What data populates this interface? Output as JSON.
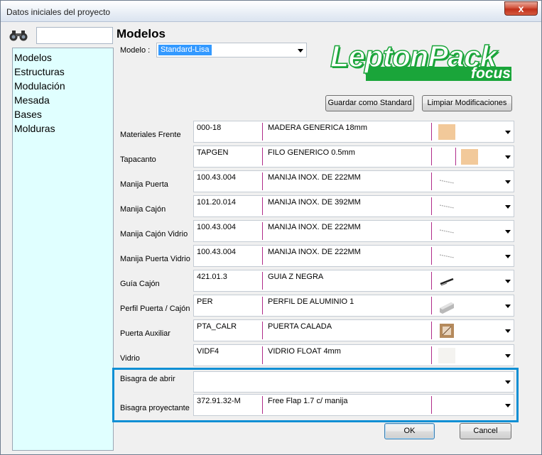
{
  "window": {
    "title": "Datos iniciales del proyecto",
    "close_glyph": "x"
  },
  "search": {
    "value": "",
    "placeholder": "",
    "icon": "binoculars-icon"
  },
  "nav": {
    "items": [
      {
        "label": "Modelos"
      },
      {
        "label": "Estructuras"
      },
      {
        "label": "Modulación"
      },
      {
        "label": "Mesada"
      },
      {
        "label": "Bases"
      },
      {
        "label": "Molduras"
      }
    ]
  },
  "header": {
    "title": "Modelos",
    "model_label": "Modelo :",
    "model_value": "Standard-Lisa"
  },
  "logo": {
    "main": "LeptonPack",
    "sub": "focus",
    "color": "#1aa53a"
  },
  "actions": {
    "save_standard": "Guardar como Standard",
    "clear_changes": "Limpiar Modificaciones"
  },
  "rows": [
    {
      "label": "Materiales Frente",
      "code": "000-18",
      "desc": "MADERA GENERICA 18mm",
      "thumb": "wood-swatch"
    },
    {
      "label": "Tapacanto",
      "code": "TAPGEN",
      "desc": "FILO GENERICO 0.5mm",
      "thumb": "wood-swatch"
    },
    {
      "label": "Manija Puerta",
      "code": "100.43.004",
      "desc": "MANIJA INOX. DE 222MM",
      "thumb": "handle-line"
    },
    {
      "label": "Manija Cajón",
      "code": "101.20.014",
      "desc": "MANIJA INOX. DE 392MM",
      "thumb": "handle-line"
    },
    {
      "label": "Manija Cajón Vidrio",
      "code": "100.43.004",
      "desc": "MANIJA INOX. DE 222MM",
      "thumb": "handle-line"
    },
    {
      "label": "Manija Puerta Vidrio",
      "code": "100.43.004",
      "desc": "MANIJA INOX. DE 222MM",
      "thumb": "handle-line"
    },
    {
      "label": "Guía Cajón",
      "code": "421.01.3",
      "desc": "GUIA Z NEGRA",
      "thumb": "rail"
    },
    {
      "label": "Perfil Puerta / Cajón",
      "code": "PER",
      "desc": "PERFIL DE ALUMINIO 1",
      "thumb": "aluminium-profile"
    },
    {
      "label": "Puerta Auxiliar",
      "code": "PTA_CALR",
      "desc": "PUERTA CALADA",
      "thumb": "door-frame"
    },
    {
      "label": "Vidrio",
      "code": "VIDF4",
      "desc": "VIDRIO FLOAT 4mm",
      "thumb": "glass-swatch"
    },
    {
      "label": "Bisagra de abrir",
      "code": "",
      "desc": "",
      "thumb": ""
    },
    {
      "label": "Bisagra proyectante",
      "code": "372.91.32-M",
      "desc": "Free Flap 1.7 c/ manija",
      "thumb": ""
    }
  ],
  "footer": {
    "ok": "OK",
    "cancel": "Cancel"
  },
  "colors": {
    "nav_bg": "#e0ffff",
    "highlight": "#0f8fd4",
    "separator": "#b02b8a"
  }
}
